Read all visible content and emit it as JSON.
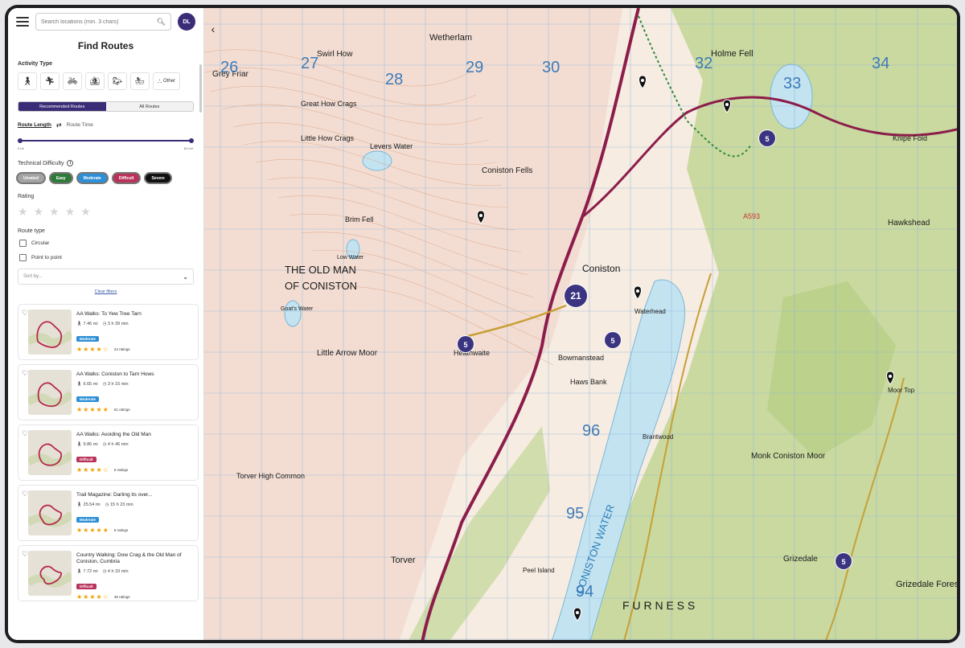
{
  "search": {
    "placeholder": "Search locations (min. 3 chars)"
  },
  "user": {
    "initials": "DL"
  },
  "panel": {
    "title": "Find Routes"
  },
  "activity": {
    "label": "Activity Type",
    "icons": [
      "walking-icon",
      "running-icon",
      "cycling-icon",
      "mountain-biking-icon",
      "horse-riding-icon",
      "water-sports-icon"
    ],
    "other_label": "Other"
  },
  "tabs": {
    "recommended": "Recommended Routes",
    "all": "All Routes"
  },
  "length_tabs": {
    "length": "Route Length",
    "time": "Route Time"
  },
  "slider": {
    "min_label": "0 mi",
    "max_label": "62 mi+",
    "range_min": 0,
    "range_max": 62
  },
  "difficulty": {
    "label": "Technical Difficulty",
    "levels": [
      {
        "label": "Unrated",
        "color": "#a3a3a3"
      },
      {
        "label": "Easy",
        "color": "#2f7a3a"
      },
      {
        "label": "Moderate",
        "color": "#2e8fd6"
      },
      {
        "label": "Difficult",
        "color": "#b8325a"
      },
      {
        "label": "Severe",
        "color": "#111111"
      }
    ]
  },
  "rating": {
    "label": "Rating",
    "selected": 0
  },
  "route_type": {
    "label": "Route type",
    "options": [
      "Circular",
      "Point to point"
    ]
  },
  "sort": {
    "placeholder": "Sort by..."
  },
  "clear_filters": "Clear filters",
  "routes": [
    {
      "title": "AA Walks: To Yew Tree Tarn",
      "distance": "7.46 mi",
      "time": "3 h 39 min",
      "difficulty": "Moderate",
      "difficulty_color": "#2e8fd6",
      "stars": 4,
      "ratings": "24 ratings"
    },
    {
      "title": "AA Walks: Coniston to Tarn Hows",
      "distance": "6.65 mi",
      "time": "3 h 15 min",
      "difficulty": "Moderate",
      "difficulty_color": "#2e8fd6",
      "stars": 4.5,
      "ratings": "61 ratings"
    },
    {
      "title": "AA Walks: Avoiding the Old Man",
      "distance": "9.86 mi",
      "time": "4 h 46 min",
      "difficulty": "Difficult",
      "difficulty_color": "#b8325a",
      "stars": 4,
      "ratings": "6 ratings"
    },
    {
      "title": "Trail Magazine: Darling its over...",
      "distance": "25.54 mi",
      "time": "15 h 23 min",
      "difficulty": "Moderate",
      "difficulty_color": "#2e8fd6",
      "stars": 4.5,
      "ratings": "6 ratings"
    },
    {
      "title": "Country Walking: Dow Crag & the Old Man of Coniston, Cumbria",
      "distance": "7.72 mi",
      "time": "4 h 33 min",
      "difficulty": "Difficult",
      "difficulty_color": "#b8325a",
      "stars": 4,
      "ratings": "35 ratings"
    }
  ],
  "map": {
    "grid_numbers_top": [
      "26",
      "27",
      "28",
      "29",
      "30",
      "32",
      "33",
      "34"
    ],
    "grid_numbers_side": [
      "96",
      "95",
      "94"
    ],
    "places": [
      {
        "name": "Wetherlam"
      },
      {
        "name": "Holme Fell"
      },
      {
        "name": "Swirl How"
      },
      {
        "name": "Grey Friar"
      },
      {
        "name": "Great How Crags"
      },
      {
        "name": "Little How Crags"
      },
      {
        "name": "Levers Water"
      },
      {
        "name": "Coniston Fells"
      },
      {
        "name": "Brim Fell"
      },
      {
        "name": "Low Water"
      },
      {
        "name": "THE OLD MAN"
      },
      {
        "name": "OF CONISTON"
      },
      {
        "name": "Goat's Water"
      },
      {
        "name": "Little Arrow Moor"
      },
      {
        "name": "Coniston"
      },
      {
        "name": "Waterhead"
      },
      {
        "name": "Bowmanstead"
      },
      {
        "name": "Haws Bank"
      },
      {
        "name": "Heathwaite"
      },
      {
        "name": "Torver High Common"
      },
      {
        "name": "Torver"
      },
      {
        "name": "CONISTON WATER"
      },
      {
        "name": "Hawkshead"
      },
      {
        "name": "Monk Coniston Moor"
      },
      {
        "name": "Grizedale"
      },
      {
        "name": "Grizedale Forest"
      },
      {
        "name": "F U R N E S S"
      },
      {
        "name": "Knipe Fold"
      },
      {
        "name": "Moor Top"
      },
      {
        "name": "Brantwood"
      },
      {
        "name": "Peel Island"
      }
    ],
    "clusters": [
      "5",
      "5",
      "21",
      "5",
      "5"
    ],
    "road_label": "A593"
  }
}
